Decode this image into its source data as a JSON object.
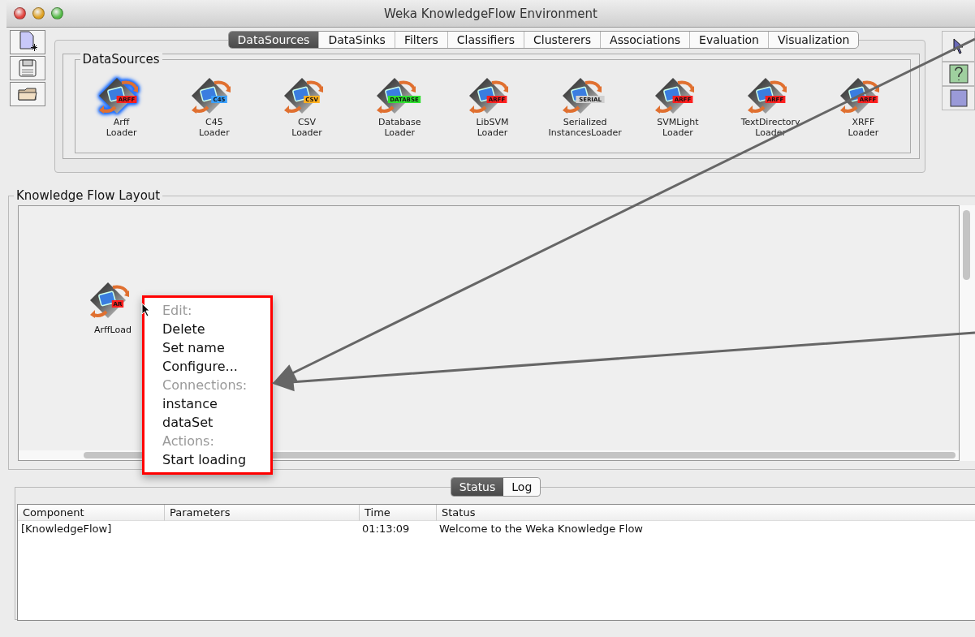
{
  "window": {
    "title": "Weka KnowledgeFlow Environment"
  },
  "tabs": [
    {
      "label": "DataSources",
      "selected": true
    },
    {
      "label": "DataSinks",
      "selected": false
    },
    {
      "label": "Filters",
      "selected": false
    },
    {
      "label": "Classifiers",
      "selected": false
    },
    {
      "label": "Clusterers",
      "selected": false
    },
    {
      "label": "Associations",
      "selected": false
    },
    {
      "label": "Evaluation",
      "selected": false
    },
    {
      "label": "Visualization",
      "selected": false
    }
  ],
  "palette": {
    "title": "DataSources",
    "items": [
      {
        "lines": [
          "Arff",
          "Loader"
        ],
        "tag": "ARFF",
        "color": "#ff2020",
        "selected": true
      },
      {
        "lines": [
          "C45",
          "Loader"
        ],
        "tag": "C45",
        "color": "#3aa0ff",
        "selected": false
      },
      {
        "lines": [
          "CSV",
          "Loader"
        ],
        "tag": "CSV",
        "color": "#ffb020",
        "selected": false
      },
      {
        "lines": [
          "Database",
          "Loader"
        ],
        "tag": "DATABSE",
        "color": "#30e030",
        "selected": false
      },
      {
        "lines": [
          "LibSVM",
          "Loader"
        ],
        "tag": "ARFF",
        "color": "#ff2020",
        "selected": false
      },
      {
        "lines": [
          "Serialized",
          "InstancesLoader"
        ],
        "tag": "SERIAL",
        "color": "#d0d0d0",
        "selected": false
      },
      {
        "lines": [
          "SVMLight",
          "Loader"
        ],
        "tag": "ARFF",
        "color": "#ff2020",
        "selected": false
      },
      {
        "lines": [
          "TextDirectory",
          "Loader"
        ],
        "tag": "ARFF",
        "color": "#ff2020",
        "selected": false
      },
      {
        "lines": [
          "XRFF",
          "Loader"
        ],
        "tag": "ARFF",
        "color": "#ff2020",
        "selected": false
      }
    ]
  },
  "layout": {
    "title": "Knowledge Flow Layout",
    "node": {
      "label": "ArffLoad",
      "tag": "AR"
    }
  },
  "context_menu": [
    {
      "kind": "header",
      "label": "Edit:"
    },
    {
      "kind": "item",
      "label": "Delete"
    },
    {
      "kind": "item",
      "label": "Set name"
    },
    {
      "kind": "item",
      "label": "Configure..."
    },
    {
      "kind": "header",
      "label": "Connections:"
    },
    {
      "kind": "item",
      "label": "instance"
    },
    {
      "kind": "item",
      "label": "dataSet"
    },
    {
      "kind": "header",
      "label": "Actions:"
    },
    {
      "kind": "item",
      "label": "Start loading"
    }
  ],
  "bottom_tabs": [
    {
      "label": "Status",
      "selected": true
    },
    {
      "label": "Log",
      "selected": false
    }
  ],
  "table": {
    "columns": [
      "Component",
      "Parameters",
      "Time",
      "Status"
    ],
    "rows": [
      [
        "[KnowledgeFlow]",
        "",
        "01:13:09",
        "Welcome to the Weka Knowledge Flow"
      ]
    ]
  }
}
